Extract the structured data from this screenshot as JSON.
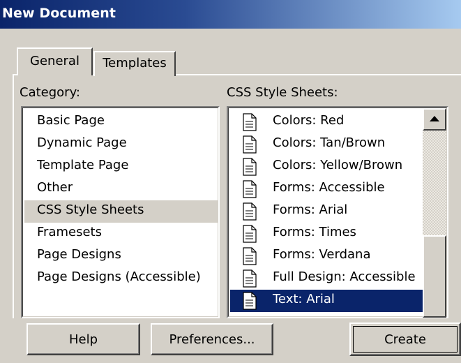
{
  "window": {
    "title": "New Document"
  },
  "tabs": [
    {
      "label": "General",
      "active": true
    },
    {
      "label": "Templates",
      "active": false
    }
  ],
  "category": {
    "label": "Category:",
    "items": [
      "Basic Page",
      "Dynamic Page",
      "Template Page",
      "Other",
      "CSS Style Sheets",
      "Framesets",
      "Page Designs",
      "Page Designs (Accessible)"
    ],
    "selected": "CSS Style Sheets"
  },
  "css": {
    "label": "CSS Style Sheets:",
    "item_icon": "document-icon",
    "items": [
      "Colors: Red",
      "Colors: Tan/Brown",
      "Colors: Yellow/Brown",
      "Forms: Accessible",
      "Forms: Arial",
      "Forms: Times",
      "Forms: Verdana",
      "Full Design: Accessible",
      "Text: Arial"
    ],
    "selected": "Text: Arial"
  },
  "buttons": {
    "help": "Help",
    "preferences": "Preferences...",
    "create": "Create"
  },
  "colors": {
    "selection": "#0a246a",
    "face": "#d4d0c8"
  }
}
